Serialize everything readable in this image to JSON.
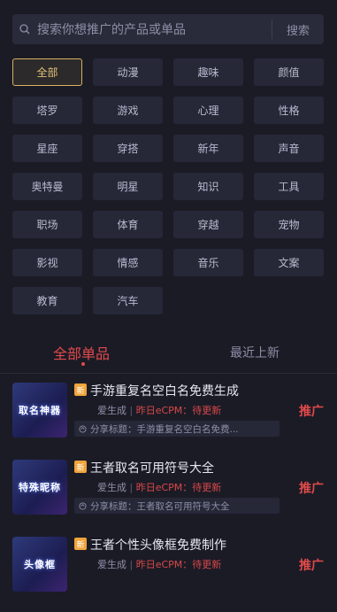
{
  "search": {
    "placeholder": "搜索你想推广的产品或单品",
    "button": "搜索"
  },
  "categories": [
    "全部",
    "动漫",
    "趣味",
    "颜值",
    "塔罗",
    "游戏",
    "心理",
    "性格",
    "星座",
    "穿搭",
    "新年",
    "声音",
    "奥特曼",
    "明星",
    "知识",
    "工具",
    "职场",
    "体育",
    "穿越",
    "宠物",
    "影视",
    "情感",
    "音乐",
    "文案",
    "教育",
    "汽车"
  ],
  "active_category": "全部",
  "tabs": {
    "all": "全部单品",
    "recent": "最近上新"
  },
  "products": [
    {
      "thumb": "取名神器",
      "badge": "新",
      "title": "手游重复名空白名免费生成",
      "source": "爱生成",
      "ecpm": "昨日eCPM：待更新",
      "share": "分享标题：手游重复名空白名免费...",
      "action": "推广"
    },
    {
      "thumb": "特殊昵称",
      "badge": "新",
      "title": "王者取名可用符号大全",
      "source": "爱生成",
      "ecpm": "昨日eCPM：待更新",
      "share": "分享标题：王者取名可用符号大全",
      "action": "推广"
    },
    {
      "thumb": "头像框",
      "badge": "新",
      "title": "王者个性头像框免费制作",
      "source": "爱生成",
      "ecpm": "昨日eCPM：待更新",
      "share": "",
      "action": "推广"
    }
  ],
  "colors": {
    "accent": "#e24a4a",
    "active_border": "#d7b25f",
    "badge": "#f0a43a"
  }
}
